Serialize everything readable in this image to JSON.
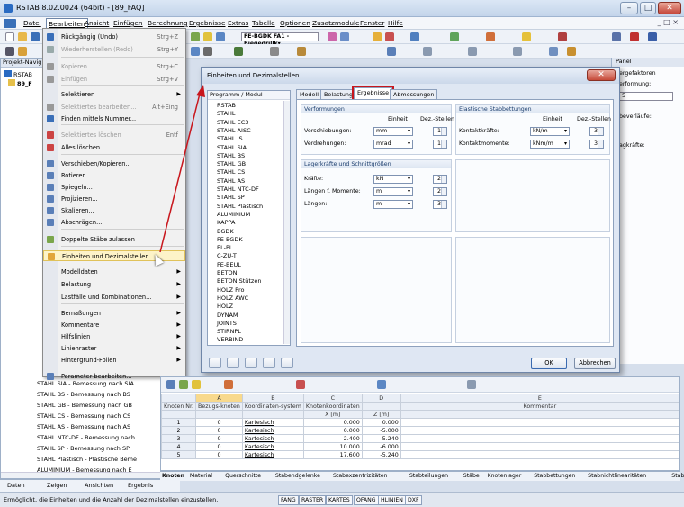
{
  "window": {
    "title": "RSTAB 8.02.0024 (64bit) - [89_FAQ]",
    "min": "–",
    "max": "□",
    "close": "✕"
  },
  "menu": [
    "Datei",
    "Bearbeiten",
    "Ansicht",
    "Einfügen",
    "Berechnung",
    "Ergebnisse",
    "Extras",
    "Tabelle",
    "Optionen",
    "Zusatzmodule",
    "Fenster",
    "Hilfe"
  ],
  "toolbar": {
    "model_combo": "FE-BGDK FA1 - Biegedrillk▾"
  },
  "context_menu": {
    "items": [
      {
        "label": "Rückgängig (Undo)",
        "shortcut": "Strg+Z",
        "disabled": false
      },
      {
        "label": "Wiederherstellen (Redo)",
        "shortcut": "Strg+Y",
        "disabled": true
      },
      {
        "label": "Kopieren",
        "shortcut": "Strg+C",
        "disabled": true
      },
      {
        "label": "Einfügen",
        "shortcut": "Strg+V",
        "disabled": true
      },
      {
        "label": "Selektieren",
        "shortcut": "",
        "disabled": false,
        "sub": true
      },
      {
        "label": "Selektiertes bearbeiten...",
        "shortcut": "Alt+Eing",
        "disabled": true
      },
      {
        "label": "Finden mittels Nummer...",
        "shortcut": "",
        "disabled": false
      },
      {
        "label": "Selektiertes löschen",
        "shortcut": "Entf",
        "disabled": true
      },
      {
        "label": "Alles löschen",
        "shortcut": "",
        "disabled": false
      },
      {
        "label": "Verschieben/Kopieren...",
        "shortcut": "",
        "disabled": false
      },
      {
        "label": "Rotieren...",
        "shortcut": "",
        "disabled": false
      },
      {
        "label": "Spiegeln...",
        "shortcut": "",
        "disabled": false
      },
      {
        "label": "Projizieren...",
        "shortcut": "",
        "disabled": false
      },
      {
        "label": "Skalieren...",
        "shortcut": "",
        "disabled": false
      },
      {
        "label": "Abschrägen...",
        "shortcut": "",
        "disabled": false
      },
      {
        "label": "Doppelte Stäbe zulassen",
        "shortcut": "",
        "disabled": false
      },
      {
        "label": "Einheiten und Dezimalstellen...",
        "shortcut": "",
        "disabled": false
      },
      {
        "label": "Modelldaten",
        "shortcut": "",
        "disabled": false,
        "sub": true
      },
      {
        "label": "Belastung",
        "shortcut": "",
        "disabled": false,
        "sub": true
      },
      {
        "label": "Lastfälle und Kombinationen...",
        "shortcut": "",
        "disabled": false,
        "sub": true
      },
      {
        "label": "Bemaßungen",
        "shortcut": "",
        "disabled": false,
        "sub": true
      },
      {
        "label": "Kommentare",
        "shortcut": "",
        "disabled": false,
        "sub": true
      },
      {
        "label": "Hilfslinien",
        "shortcut": "",
        "disabled": false,
        "sub": true
      },
      {
        "label": "Linienraster",
        "shortcut": "",
        "disabled": false,
        "sub": true
      },
      {
        "label": "Hintergrund-Folien",
        "shortcut": "",
        "disabled": false,
        "sub": true
      },
      {
        "label": "Parameter bearbeiten...",
        "shortcut": "",
        "disabled": false
      }
    ]
  },
  "dialog": {
    "title": "Einheiten und Dezimalstellen",
    "tree_header": "Programm / Modul",
    "modules": [
      "RSTAB",
      "STAHL",
      "STAHL EC3",
      "STAHL AISC",
      "STAHL IS",
      "STAHL SIA",
      "STAHL BS",
      "STAHL GB",
      "STAHL CS",
      "STAHL AS",
      "STAHL NTC-DF",
      "STAHL SP",
      "STAHL Plastisch",
      "ALUMINIUM",
      "KAPPA",
      "BGDK",
      "FE-BGDK",
      "EL-PL",
      "C-ZU-T",
      "FE-BEUL",
      "BETON",
      "BETON Stützen",
      "HOLZ Pro",
      "HOLZ AWC",
      "HOLZ",
      "DYNAM",
      "JOINTS",
      "STIRNPL",
      "VERBIND"
    ],
    "tabs": [
      "Modell",
      "Belastung",
      "Ergebnisse",
      "Abmessungen"
    ],
    "selected_tab": "Ergebnisse",
    "col_einheit": "Einheit",
    "col_dez": "Dez.-Stellen",
    "verformungen": {
      "title": "Verformungen",
      "rows": [
        {
          "label": "Verschiebungen:",
          "unit": "mm",
          "dec": "1"
        },
        {
          "label": "Verdrehungen:",
          "unit": "mrad",
          "dec": "1"
        }
      ]
    },
    "elastische": {
      "title": "Elastische Stabbettungen",
      "rows": [
        {
          "label": "Kontaktkräfte:",
          "unit": "kN/m",
          "dec": "3"
        },
        {
          "label": "Kontaktmomente:",
          "unit": "kNm/m",
          "dec": "3"
        }
      ]
    },
    "lager": {
      "title": "Lagerkräfte und Schnittgrößen",
      "rows": [
        {
          "label": "Kräfte:",
          "unit": "kN",
          "dec": "2"
        },
        {
          "label": "Längen f. Momente:",
          "unit": "m",
          "dec": "2"
        },
        {
          "label": "Längen:",
          "unit": "m",
          "dec": "3"
        }
      ]
    },
    "ok": "OK",
    "cancel": "Abbrechen"
  },
  "nav": {
    "header": "Projekt-Navig",
    "root": "RSTAB",
    "project": "89_F",
    "items": [
      "STAHL SIA - Bemessung nach SIA",
      "STAHL BS - Bemessung nach BS",
      "STAHL GB - Bemessung nach GB",
      "STAHL CS - Bemessung nach CS",
      "STAHL AS - Bemessung nach AS",
      "STAHL NTC-DF - Bemessung nach",
      "STAHL SP - Bemessung nach SP",
      "STAHL Plastisch - Plastische Beme",
      "ALUMINIUM - Bemessung nach E"
    ],
    "tabs": [
      "Daten",
      "Zeigen",
      "Ansichten",
      "Ergebnis"
    ]
  },
  "right_panel": {
    "title": "Panel",
    "l1": "ergefaktoren",
    "l2": "erformung:",
    "value": "5",
    "l3": "beverläufe:",
    "l4": "agkräfte:"
  },
  "table": {
    "col_letters": [
      "A",
      "B",
      "C",
      "D",
      "E"
    ],
    "headers": {
      "knoten": "Knoten Nr.",
      "bezug": "Bezugs-knoten",
      "system": "Koordinaten-system",
      "kk": "Knotenkoordinaten",
      "x": "X [m]",
      "z": "Z [m]",
      "kommentar": "Kommentar"
    },
    "rows": [
      {
        "nr": "1",
        "bezug": "0",
        "system": "Kartesisch",
        "x": "0.000",
        "z": "0.000"
      },
      {
        "nr": "2",
        "bezug": "0",
        "system": "Kartesisch",
        "x": "0.000",
        "z": "-5.000"
      },
      {
        "nr": "3",
        "bezug": "0",
        "system": "Kartesisch",
        "x": "2.400",
        "z": "-5.240"
      },
      {
        "nr": "4",
        "bezug": "0",
        "system": "Kartesisch",
        "x": "10.000",
        "z": "-6.000"
      },
      {
        "nr": "5",
        "bezug": "0",
        "system": "Kartesisch",
        "x": "17.600",
        "z": "-5.240"
      }
    ],
    "sheet_tabs": [
      "Knoten",
      "Material",
      "Querschnitte",
      "Stabendgelenke",
      "Stabexzentrizitäten",
      "Stabteilungen",
      "Stäbe",
      "Knotenlager",
      "Stabbettungen",
      "Stabnichtlinearitäten",
      "Stabsätze"
    ]
  },
  "status": {
    "text": "Ermöglicht, die Einheiten und die Anzahl der Dezimalstellen einzustellen.",
    "buttons": [
      "FANG",
      "RASTER",
      "KARTES",
      "OFANG",
      "HLINIEN",
      "DXF"
    ]
  }
}
